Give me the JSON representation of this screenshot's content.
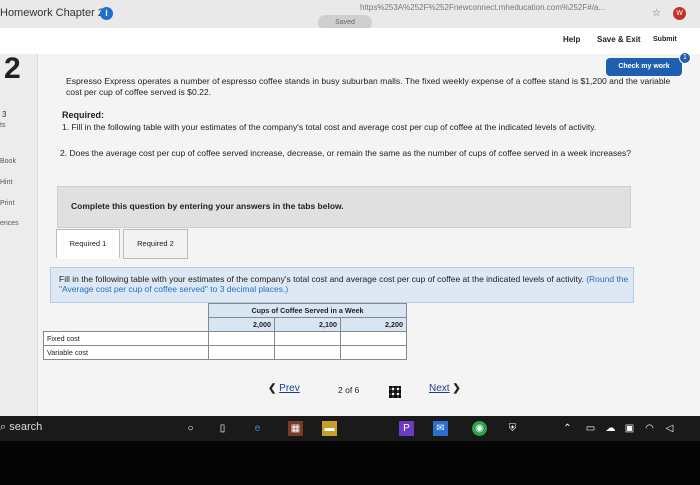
{
  "browser": {
    "tab_title": "Homework Chapter 2",
    "info_icon": "i",
    "url": "https%253A%252F%252Fnewconnect.mheducation.com%252F#/a...",
    "saved_status": "Saved",
    "ext_label": "W"
  },
  "header": {
    "help": "Help",
    "save_exit": "Save & Exit",
    "submit": "Submit"
  },
  "sidebar": {
    "question_number": "2",
    "points": "3",
    "points_unit": "ts",
    "items": [
      "Book",
      "Hint",
      "Print",
      "ences"
    ]
  },
  "check_work": {
    "label": "Check my work",
    "badge": "1"
  },
  "question": {
    "intro": "Espresso Express operates a number of espresso coffee stands in busy suburban malls. The fixed weekly expense of a coffee stand is $1,200 and the variable cost per cup of coffee served is $0.22.",
    "required_heading": "Required:",
    "requirement_1": "1. Fill in the following table with your estimates of the company's total cost and average cost per cup of coffee at the indicated levels of activity.",
    "requirement_2": "2. Does the average cost per cup of coffee served increase, decrease, or remain the same as the number of cups of coffee served in a week increases?"
  },
  "instructions": {
    "complete_text": "Complete this question by entering your answers in the tabs below."
  },
  "tabs": [
    {
      "label": "Required 1"
    },
    {
      "label": "Required 2"
    }
  ],
  "fill_box": {
    "text": "Fill in the following table with your estimates of the company's total cost and average cost per cup of coffee at the indicated levels of activity.",
    "note": "(Round the \"Average cost per cup of coffee served\" to 3 decimal places.)"
  },
  "table": {
    "group_header": "Cups of Coffee Served in a Week",
    "columns": [
      "2,000",
      "2,100",
      "2,200"
    ],
    "rows": [
      {
        "label": "Fixed cost"
      },
      {
        "label": "Variable cost"
      }
    ]
  },
  "pager": {
    "prev": "Prev",
    "page_info": "2 of 6",
    "next": "Next"
  },
  "taskbar": {
    "search": "search"
  }
}
